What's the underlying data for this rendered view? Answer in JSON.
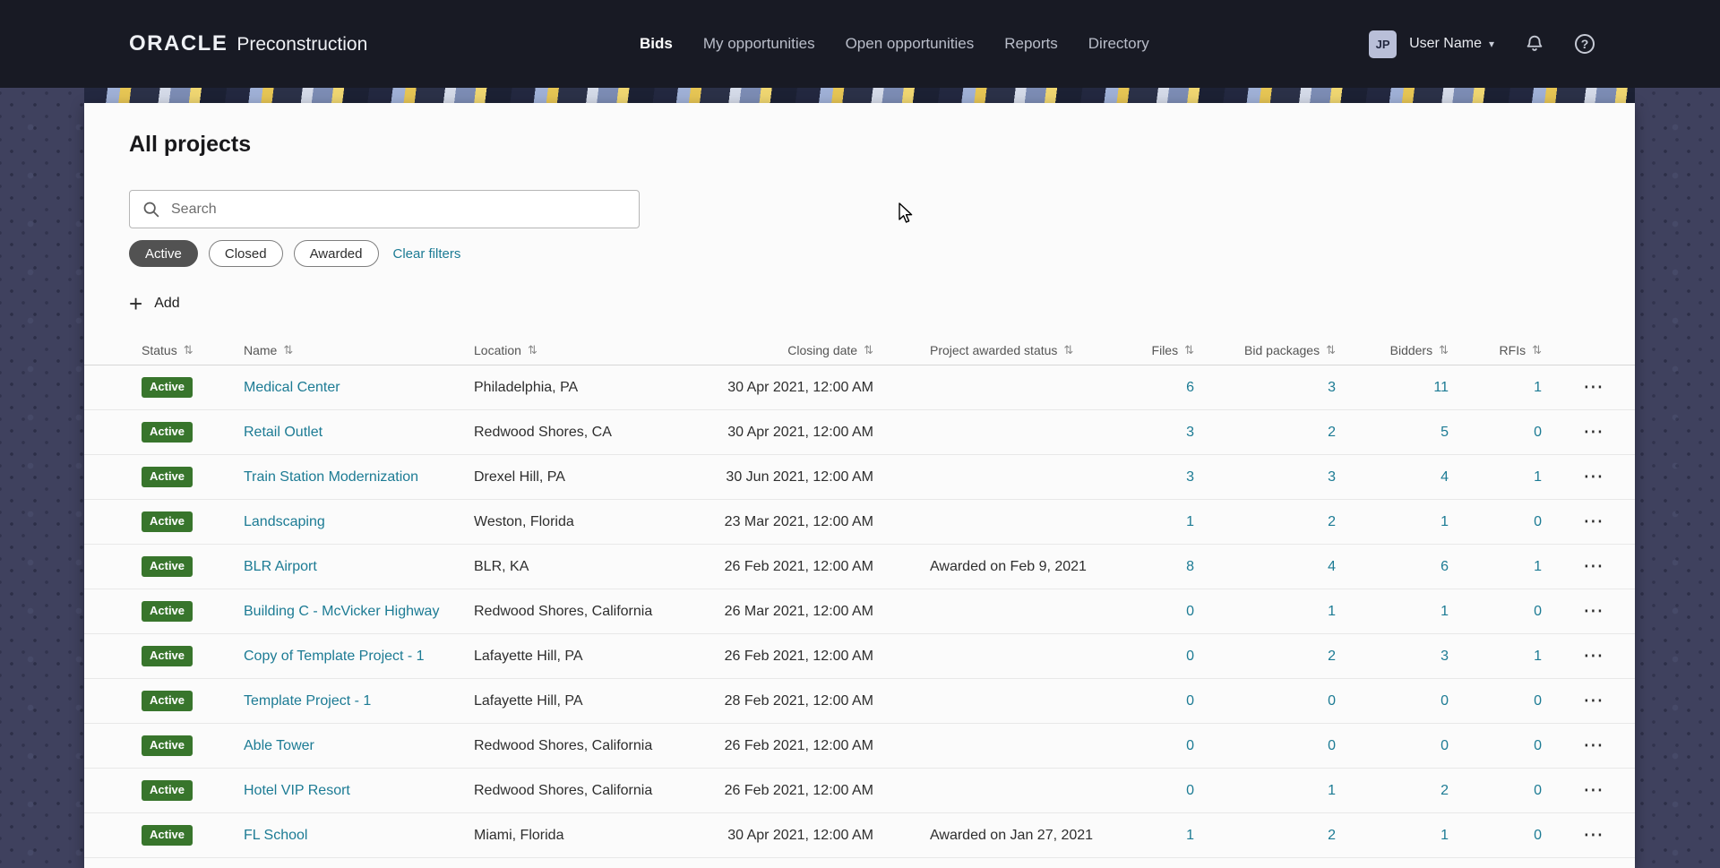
{
  "header": {
    "brand": {
      "logo": "ORACLE",
      "product": "Preconstruction"
    },
    "nav": [
      {
        "label": "Bids",
        "active": true
      },
      {
        "label": "My opportunities",
        "active": false
      },
      {
        "label": "Open opportunities",
        "active": false
      },
      {
        "label": "Reports",
        "active": false
      },
      {
        "label": "Directory",
        "active": false
      }
    ],
    "user": {
      "initials": "JP",
      "name": "User Name"
    }
  },
  "page": {
    "title": "All projects",
    "search_placeholder": "Search",
    "filters": {
      "chips": [
        {
          "label": "Active",
          "selected": true
        },
        {
          "label": "Closed",
          "selected": false
        },
        {
          "label": "Awarded",
          "selected": false
        }
      ],
      "clear_label": "Clear filters"
    },
    "add_label": "Add"
  },
  "table": {
    "columns": [
      "Status",
      "Name",
      "Location",
      "Closing date",
      "Project awarded status",
      "Files",
      "Bid packages",
      "Bidders",
      "RFIs"
    ],
    "rows": [
      {
        "status": "Active",
        "name": "Medical Center",
        "location": "Philadelphia, PA",
        "closing": "30 Apr 2021, 12:00 AM",
        "awarded": "",
        "files": "6",
        "bid_packages": "3",
        "bidders": "11",
        "rfis": "1"
      },
      {
        "status": "Active",
        "name": "Retail Outlet",
        "location": "Redwood Shores, CA",
        "closing": "30 Apr 2021, 12:00 AM",
        "awarded": "",
        "files": "3",
        "bid_packages": "2",
        "bidders": "5",
        "rfis": "0"
      },
      {
        "status": "Active",
        "name": "Train Station Modernization",
        "location": "Drexel Hill, PA",
        "closing": "30 Jun 2021, 12:00 AM",
        "awarded": "",
        "files": "3",
        "bid_packages": "3",
        "bidders": "4",
        "rfis": "1"
      },
      {
        "status": "Active",
        "name": "Landscaping",
        "location": "Weston, Florida",
        "closing": "23 Mar 2021, 12:00 AM",
        "awarded": "",
        "files": "1",
        "bid_packages": "2",
        "bidders": "1",
        "rfis": "0"
      },
      {
        "status": "Active",
        "name": "BLR Airport",
        "location": "BLR, KA",
        "closing": "26 Feb 2021, 12:00 AM",
        "awarded": "Awarded on Feb 9, 2021",
        "files": "8",
        "bid_packages": "4",
        "bidders": "6",
        "rfis": "1"
      },
      {
        "status": "Active",
        "name": "Building C - McVicker Highway",
        "location": "Redwood Shores, California",
        "closing": "26 Mar 2021, 12:00 AM",
        "awarded": "",
        "files": "0",
        "bid_packages": "1",
        "bidders": "1",
        "rfis": "0"
      },
      {
        "status": "Active",
        "name": "Copy of Template Project - 1",
        "location": "Lafayette Hill, PA",
        "closing": "26 Feb 2021, 12:00 AM",
        "awarded": "",
        "files": "0",
        "bid_packages": "2",
        "bidders": "3",
        "rfis": "1"
      },
      {
        "status": "Active",
        "name": "Template Project - 1",
        "location": "Lafayette Hill, PA",
        "closing": "28 Feb 2021, 12:00 AM",
        "awarded": "",
        "files": "0",
        "bid_packages": "0",
        "bidders": "0",
        "rfis": "0"
      },
      {
        "status": "Active",
        "name": "Able Tower",
        "location": "Redwood Shores, California",
        "closing": "26 Feb 2021, 12:00 AM",
        "awarded": "",
        "files": "0",
        "bid_packages": "0",
        "bidders": "0",
        "rfis": "0"
      },
      {
        "status": "Active",
        "name": "Hotel VIP Resort",
        "location": "Redwood Shores, California",
        "closing": "26 Feb 2021, 12:00 AM",
        "awarded": "",
        "files": "0",
        "bid_packages": "1",
        "bidders": "2",
        "rfis": "0"
      },
      {
        "status": "Active",
        "name": "FL School",
        "location": "Miami, Florida",
        "closing": "30 Apr 2021, 12:00 AM",
        "awarded": "Awarded on Jan 27, 2021",
        "files": "1",
        "bid_packages": "2",
        "bidders": "1",
        "rfis": "0"
      }
    ]
  },
  "icons": {
    "sort_glyph": "⇅",
    "ellipsis_glyph": "⋯",
    "plus_glyph": "+",
    "caret_glyph": "▾",
    "help_glyph": "?"
  },
  "colors": {
    "accent_link": "#1c7b94",
    "status_badge_green": "#38752c",
    "topbar_bg": "#181a24",
    "page_bg": "#3f415e",
    "chip_selected_bg": "#525252"
  }
}
